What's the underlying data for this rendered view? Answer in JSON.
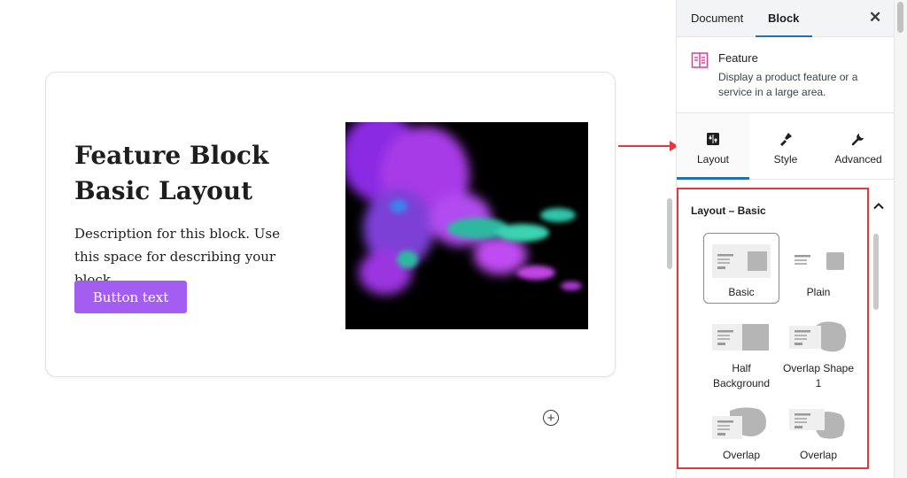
{
  "feature_block": {
    "title": "Feature Block Basic Layout",
    "description": "Description for this block. Use this space for describing your block.",
    "button_text": "Button text"
  },
  "sidebar": {
    "tabs": [
      "Document",
      "Block"
    ],
    "active_tab": "Block",
    "block_name": "Feature",
    "block_description": "Display a product feature or a service in a large area.",
    "panel_tabs": [
      {
        "label": "Layout",
        "icon": "layout-icon"
      },
      {
        "label": "Style",
        "icon": "brush-icon"
      },
      {
        "label": "Advanced",
        "icon": "wrench-icon"
      }
    ],
    "active_panel_tab": "Layout",
    "layouts_title": "Layout – Basic",
    "layouts": [
      {
        "label": "Basic",
        "selected": true
      },
      {
        "label": "Plain"
      },
      {
        "label": "Half Background"
      },
      {
        "label": "Overlap Shape 1"
      },
      {
        "label": "Overlap"
      },
      {
        "label": "Overlap"
      }
    ]
  },
  "colors": {
    "button": "#a35df0",
    "annotation": "#e23a3a",
    "tab_underline": "#2271b1",
    "block_icon": "#e23a9c"
  }
}
